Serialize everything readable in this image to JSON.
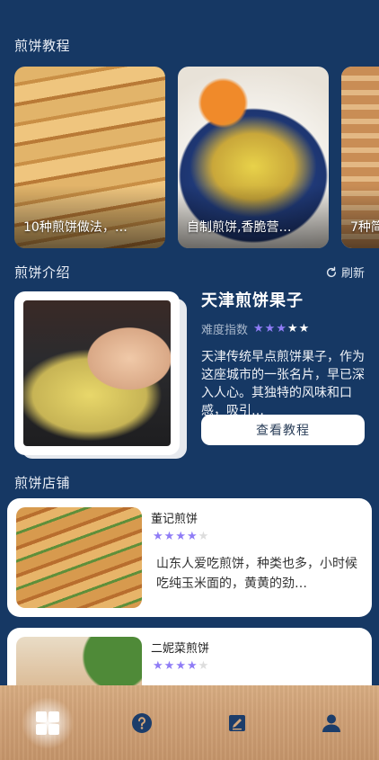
{
  "sections": {
    "tutorials_title": "煎饼教程",
    "intro_title": "煎饼介绍",
    "shops_title": "煎饼店铺"
  },
  "tutorials": [
    {
      "caption": "10种煎饼做法，…"
    },
    {
      "caption": "自制煎饼,香脆营…"
    },
    {
      "caption": "7种简"
    }
  ],
  "intro": {
    "refresh_label": "刷新",
    "name": "天津煎饼果子",
    "difficulty_label": "难度指数",
    "difficulty_stars": 3,
    "difficulty_max": 5,
    "description": "天津传统早点煎饼果子，作为这座城市的一张名片，早已深入人心。其独特的风味和口感，吸引…",
    "button_label": "查看教程"
  },
  "shops": [
    {
      "name": "董记煎饼",
      "rating": 4,
      "rating_max": 5,
      "description": "山东人爱吃煎饼，种类也多，小时候吃纯玉米面的，黄黄的劲…"
    },
    {
      "name": "二妮菜煎饼",
      "rating": 4,
      "rating_max": 5,
      "description": ""
    }
  ],
  "tabbar": {
    "icons": [
      "grid-icon",
      "help-icon",
      "edit-icon",
      "user-icon"
    ]
  },
  "colors": {
    "background": "#163864",
    "accent_star": "#8f7cf6",
    "tabbar_wood": "#cfa177",
    "icon_dark": "#1c3d6a"
  }
}
